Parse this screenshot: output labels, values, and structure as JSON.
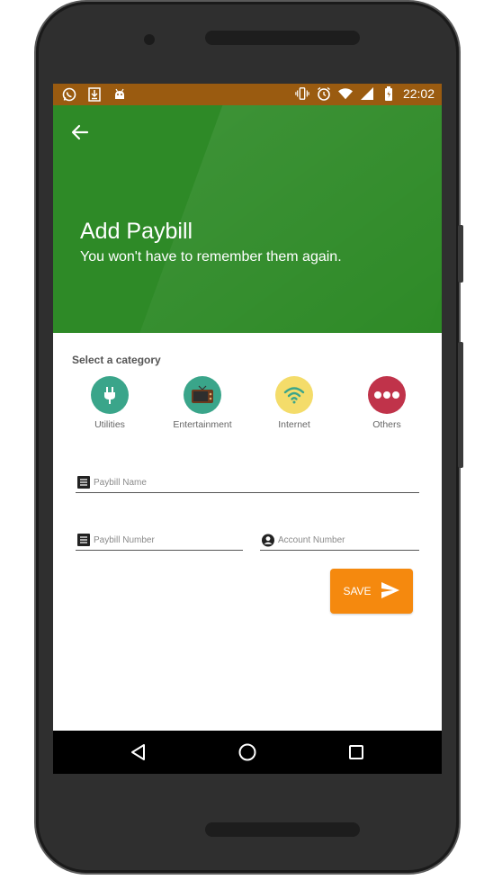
{
  "status_bar": {
    "time": "22:02",
    "left_icons": [
      "whatsapp-icon",
      "download-icon",
      "android-icon"
    ],
    "right_icons": [
      "vibrate-icon",
      "alarm-icon",
      "wifi-icon",
      "signal-icon",
      "battery-icon"
    ]
  },
  "header": {
    "title": "Add Paybill",
    "subtitle": "You won't have to remember them again.",
    "color": "#2e8a27"
  },
  "category": {
    "label": "Select a category",
    "items": [
      {
        "label": "Utilities",
        "icon": "plug-icon",
        "color": "#3aa58a"
      },
      {
        "label": "Entertainment",
        "icon": "tv-icon",
        "color": "#3aa58a"
      },
      {
        "label": "Internet",
        "icon": "wifi-icon",
        "color": "#f4dc6a"
      },
      {
        "label": "Others",
        "icon": "more-icon",
        "color": "#c0334a"
      }
    ]
  },
  "form": {
    "paybill_name_placeholder": "Paybill Name",
    "paybill_number_placeholder": "Paybill Number",
    "account_number_placeholder": "Account Number"
  },
  "actions": {
    "save_label": "SAVE",
    "accent_color": "#f5890e"
  },
  "nav": {
    "icons": [
      "back-nav-icon",
      "home-nav-icon",
      "recents-nav-icon"
    ]
  }
}
